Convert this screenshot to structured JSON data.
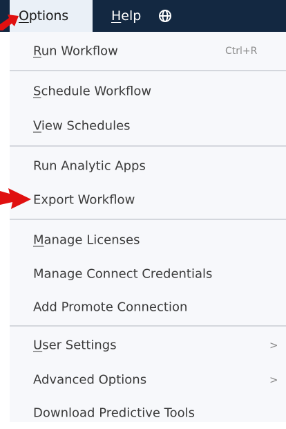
{
  "menubar": {
    "options": {
      "accel": "O",
      "rest": "ptions"
    },
    "help": {
      "accel": "H",
      "rest": "elp"
    },
    "globe_icon": "globe-icon"
  },
  "menu": {
    "run_workflow": {
      "accel": "R",
      "rest": "un Workflow",
      "shortcut": "Ctrl+R"
    },
    "schedule_workflow": {
      "accel": "S",
      "rest": "chedule Workflow"
    },
    "view_schedules": {
      "accel": "V",
      "rest": "iew Schedules"
    },
    "run_analytic_apps": {
      "label": "Run Analytic Apps"
    },
    "export_workflow": {
      "label": "Export Workflow"
    },
    "manage_licenses": {
      "accel": "M",
      "rest": "anage Licenses"
    },
    "manage_connect_credentials": {
      "label": "Manage Connect Credentials"
    },
    "add_promote_connection": {
      "label": "Add Promote Connection"
    },
    "user_settings": {
      "accel": "U",
      "rest": "ser Settings",
      "chevron": ">"
    },
    "advanced_options": {
      "label": "Advanced Options",
      "chevron": ">"
    },
    "download_predictive_tools": {
      "label": "Download Predictive Tools"
    }
  },
  "colors": {
    "menubar_bg": "#132841",
    "menu_bg": "#f7f8fb",
    "annotation_arrow": "#e01010"
  }
}
